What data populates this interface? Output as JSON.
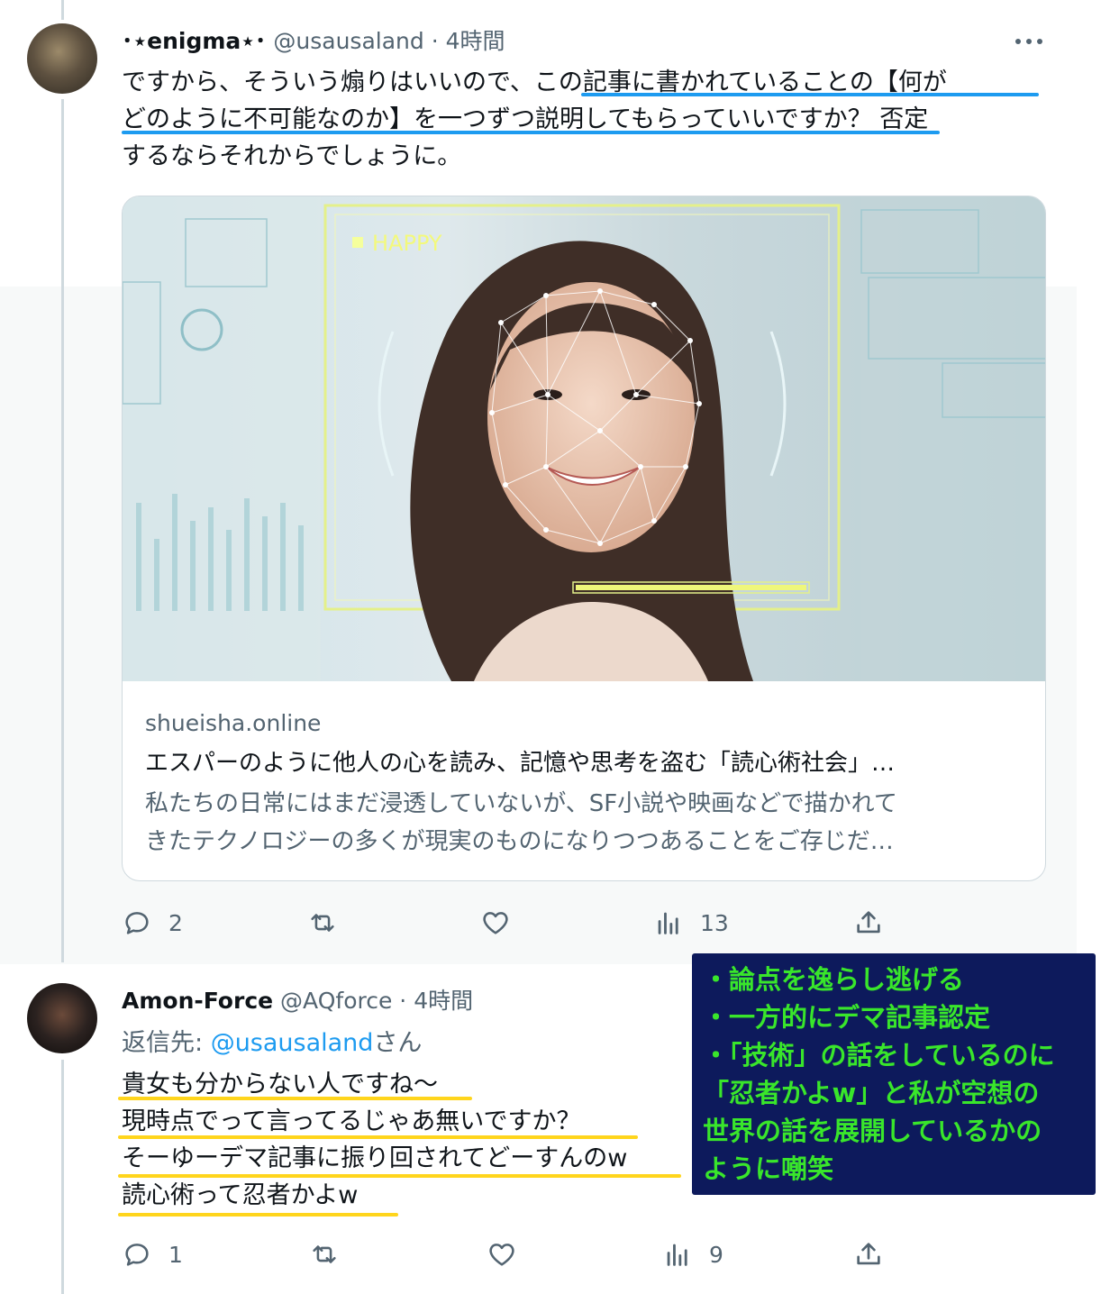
{
  "tweet1": {
    "name": "･⋆enigma⋆･",
    "handle": "@usausaland",
    "time": "4時間",
    "text_lines": [
      "ですから、そういう煽りはいいので、この記事に書かれていることの【何が",
      "どのように不可能なのか】を一つずつ説明してもらっていいですか？ 否定",
      "するならそれからでしょうに。"
    ],
    "card": {
      "image_overlay_label": "HAPPY",
      "domain": "shueisha.online",
      "title": "エスパーのように他人の心を読み、記憶や思考を盗む「読心術社会」…",
      "description_lines": [
        "私たちの日常にはまだ浸透していないが、SF小説や映画などで描かれて",
        "きたテクノロジーの多くが現実のものになりつつあることをご存じだ…"
      ]
    },
    "actions": {
      "replies": "2",
      "retweets": "",
      "likes": "",
      "views": "13"
    }
  },
  "tweet2": {
    "name": "Amon-Force",
    "handle": "@AQforce",
    "time": "4時間",
    "reply_prefix": "返信先: ",
    "reply_mention": "@usausaland",
    "reply_suffix": "さん",
    "text_lines": [
      "貴女も分からない人ですね～",
      "現時点でって言ってるじゃあ無いですか？",
      "そーゆーデマ記事に振り回されてどーすんのw",
      "読心術って忍者かよw"
    ],
    "actions": {
      "replies": "1",
      "retweets": "",
      "likes": "",
      "views": "9"
    }
  },
  "annotation": {
    "lines": [
      "・論点を逸らし逃げる",
      "・一方的にデマ記事認定",
      "・「技術」の話をしているのに",
      "「忍者かよw」と私が空想の",
      "世界の話を展開しているかの",
      "ように嘲笑"
    ]
  },
  "colors": {
    "link_blue": "#1d9bf0",
    "underline_yellow": "#ffd51c",
    "note_bg": "#0d1a5c",
    "note_text": "#39e62b",
    "secondary_text": "#536471"
  }
}
